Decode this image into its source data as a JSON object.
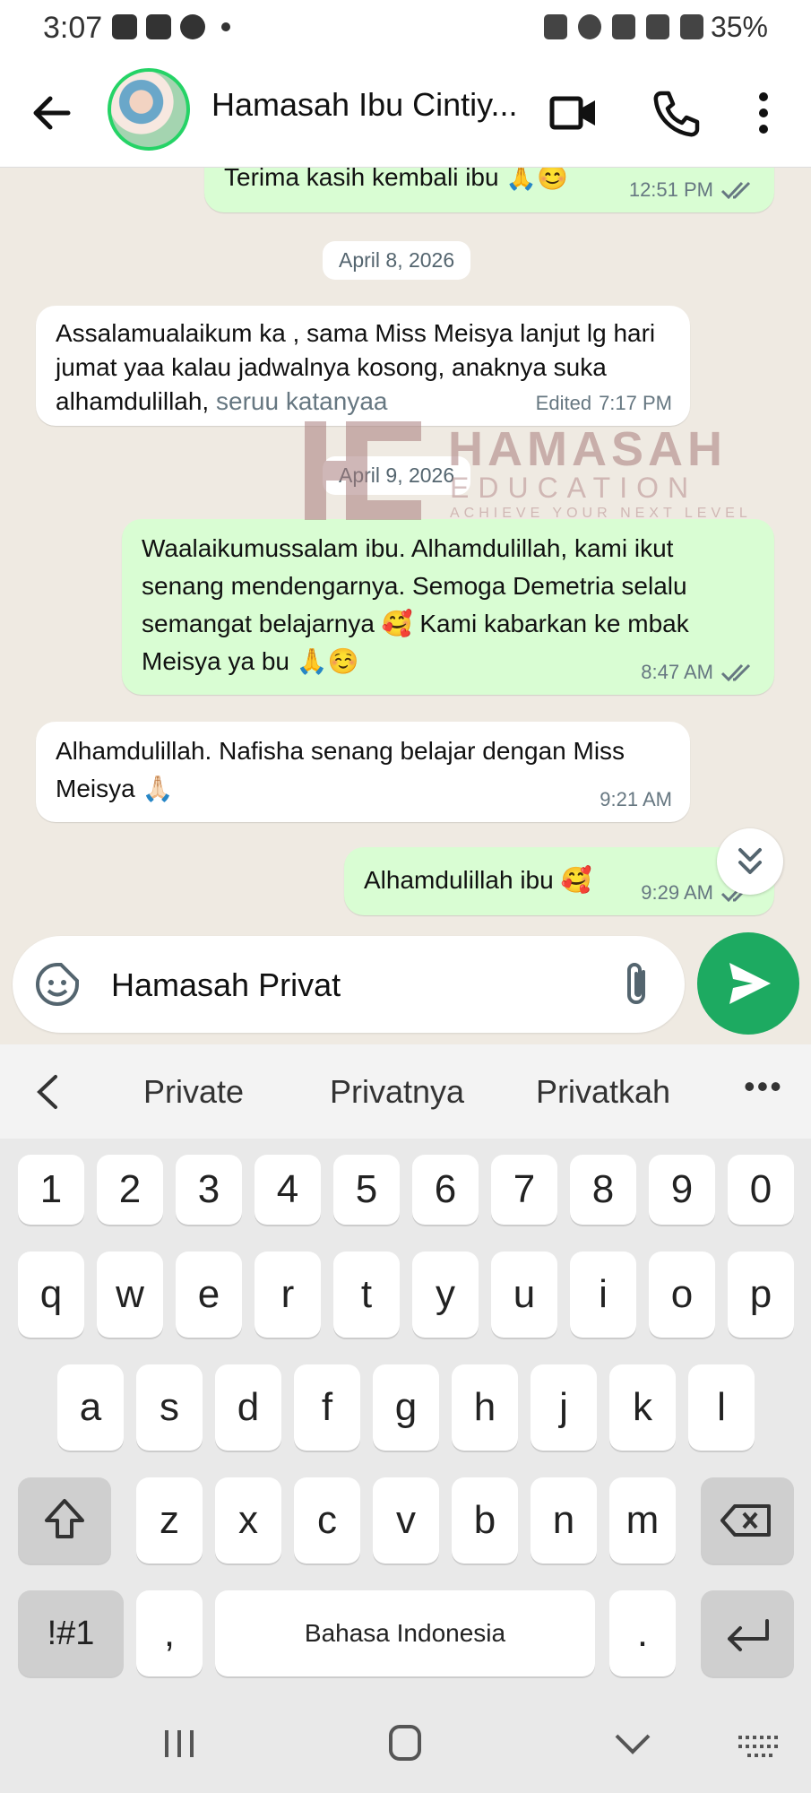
{
  "statusbar": {
    "time": "3:07",
    "battery": "35%"
  },
  "header": {
    "title": "Hamasah Ibu Cintiy..."
  },
  "chat": {
    "messages": [
      {
        "id": "m0",
        "text": "Terima kasih kembali ibu 🙏😊",
        "time": "12:51 PM"
      },
      {
        "id": "m1",
        "text_main": "Assalamualaikum ka , sama Miss Meisya lanjut lg hari jumat yaa kalau jadwalnya kosong,  anaknya suka alhamdulillah, ",
        "text_tail": "seruu katanyaa",
        "edited": "Edited",
        "time": "7:17 PM"
      },
      {
        "id": "m2",
        "text": "Waalaikumussalam ibu. Alhamdulillah, kami ikut senang mendengarnya. Semoga Demetria selalu semangat belajarnya 🥰 Kami kabarkan ke mbak Meisya ya bu 🙏☺️",
        "time": "8:47 AM"
      },
      {
        "id": "m3",
        "text": "Alhamdulillah. Nafisha senang belajar dengan Miss Meisya 🙏🏻",
        "time": "9:21 AM"
      },
      {
        "id": "m4",
        "text": "Alhamdulillah ibu 🥰",
        "time": "9:29 AM"
      }
    ],
    "date_chips": [
      "April 8, 2026",
      "April 9, 2026"
    ]
  },
  "watermark": {
    "title": "HAMASAH",
    "subtitle": "EDUCATION",
    "tagline": "ACHIEVE YOUR NEXT LEVEL"
  },
  "composer": {
    "value": "Hamasah Privat"
  },
  "suggestions": {
    "words": [
      "Private",
      "Privatnya",
      "Privatkah"
    ],
    "more": "•••"
  },
  "keyboard": {
    "row_numbers": [
      "1",
      "2",
      "3",
      "4",
      "5",
      "6",
      "7",
      "8",
      "9",
      "0"
    ],
    "row1": [
      "q",
      "w",
      "e",
      "r",
      "t",
      "y",
      "u",
      "i",
      "o",
      "p"
    ],
    "row2": [
      "a",
      "s",
      "d",
      "f",
      "g",
      "h",
      "j",
      "k",
      "l"
    ],
    "row3": [
      "z",
      "x",
      "c",
      "v",
      "b",
      "n",
      "m"
    ],
    "symbols_key": "!#1",
    "comma_key": ",",
    "space_label": "Bahasa Indonesia",
    "period_key": "."
  },
  "colors": {
    "accent": "#1daa61",
    "outgoing": "#d9fdd3",
    "incoming": "#ffffff",
    "tick": "#667781"
  },
  "icons": [
    "back-arrow-icon",
    "video-call-icon",
    "phone-icon",
    "more-vert-icon",
    "sticker-icon",
    "attach-icon",
    "send-icon",
    "double-check-icon",
    "scroll-down-icon",
    "shift-icon",
    "backspace-icon",
    "enter-icon",
    "recents-icon",
    "home-icon",
    "nav-back-icon",
    "keyboard-hide-icon"
  ]
}
